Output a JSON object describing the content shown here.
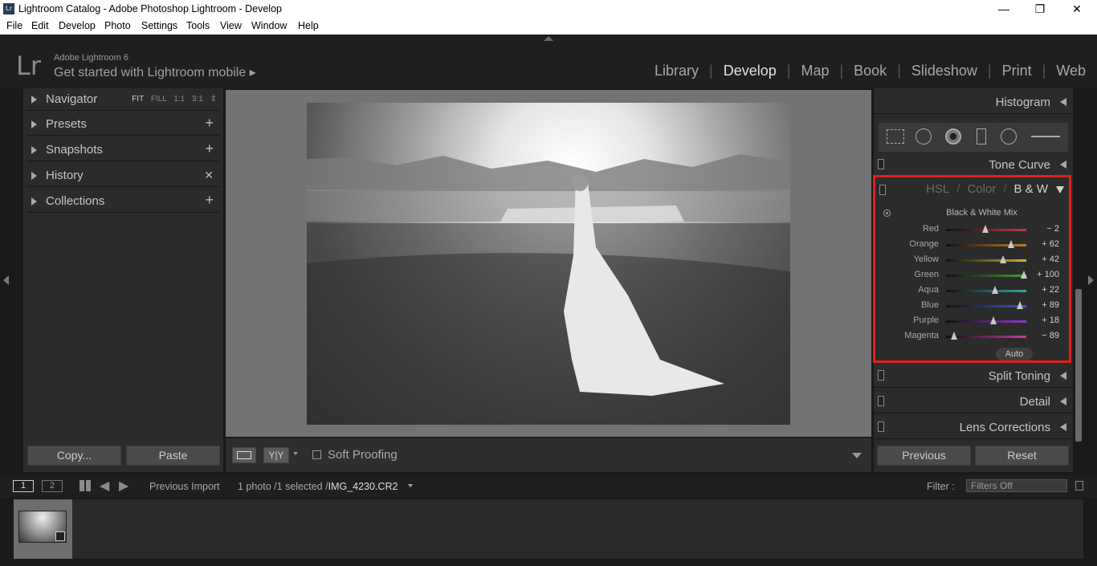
{
  "window": {
    "title": "Lightroom Catalog - Adobe Photoshop Lightroom - Develop",
    "app_icon": "Lr",
    "minimize": "—",
    "restore": "❐",
    "close": "✕"
  },
  "menu": [
    "File",
    "Edit",
    "Develop",
    "Photo",
    "Settings",
    "Tools",
    "View",
    "Window",
    "Help"
  ],
  "header": {
    "logo": "Lr",
    "product": "Adobe Lightroom 6",
    "mobile": "Get started with Lightroom mobile ▸",
    "modules": [
      "Library",
      "Develop",
      "Map",
      "Book",
      "Slideshow",
      "Print",
      "Web"
    ],
    "active_module": "Develop"
  },
  "left_panel": {
    "sections": [
      {
        "label": "Navigator"
      },
      {
        "label": "Presets",
        "action": "+"
      },
      {
        "label": "Snapshots",
        "action": "+"
      },
      {
        "label": "History",
        "action": "✕"
      },
      {
        "label": "Collections",
        "action": "+"
      }
    ],
    "zoom": {
      "fit": "FIT",
      "fill": "FILL",
      "one": "1:1",
      "three": "3:1",
      "stepper": "⇕"
    },
    "copy_label": "Copy...",
    "paste_label": "Paste"
  },
  "toolbar": {
    "soft_proofing": "Soft Proofing",
    "view_yy": "Y|Y"
  },
  "right_panel": {
    "histogram": "Histogram",
    "tone_curve": "Tone Curve",
    "hsl_tabs": {
      "hsl": "HSL",
      "color": "Color",
      "bw": "B & W"
    },
    "mix_title": "Black & White Mix",
    "sliders": [
      {
        "name": "Red",
        "value": "− 2",
        "pos": 0.49,
        "color": "#c43a3a"
      },
      {
        "name": "Orange",
        "value": "+ 62",
        "pos": 0.81,
        "color": "#c8792e"
      },
      {
        "name": "Yellow",
        "value": "+ 42",
        "pos": 0.71,
        "color": "#c8b62e"
      },
      {
        "name": "Green",
        "value": "+ 100",
        "pos": 0.97,
        "color": "#4a9a3a"
      },
      {
        "name": "Aqua",
        "value": "+ 22",
        "pos": 0.61,
        "color": "#3aa0a0"
      },
      {
        "name": "Blue",
        "value": "+ 89",
        "pos": 0.92,
        "color": "#3a5ac8"
      },
      {
        "name": "Purple",
        "value": "+ 18",
        "pos": 0.59,
        "color": "#8a3ac8"
      },
      {
        "name": "Magenta",
        "value": "− 89",
        "pos": 0.1,
        "color": "#c83aa0"
      }
    ],
    "auto": "Auto",
    "split_toning": "Split Toning",
    "detail": "Detail",
    "lens_corrections": "Lens Corrections",
    "previous": "Previous",
    "reset": "Reset"
  },
  "filmstrip_bar": {
    "screen1": "1",
    "screen2": "2",
    "source": "Previous Import",
    "count": "1 photo /1 selected /",
    "filename": "IMG_4230.CR2",
    "filter_label": "Filter :",
    "filter_value": "Filters Off"
  }
}
